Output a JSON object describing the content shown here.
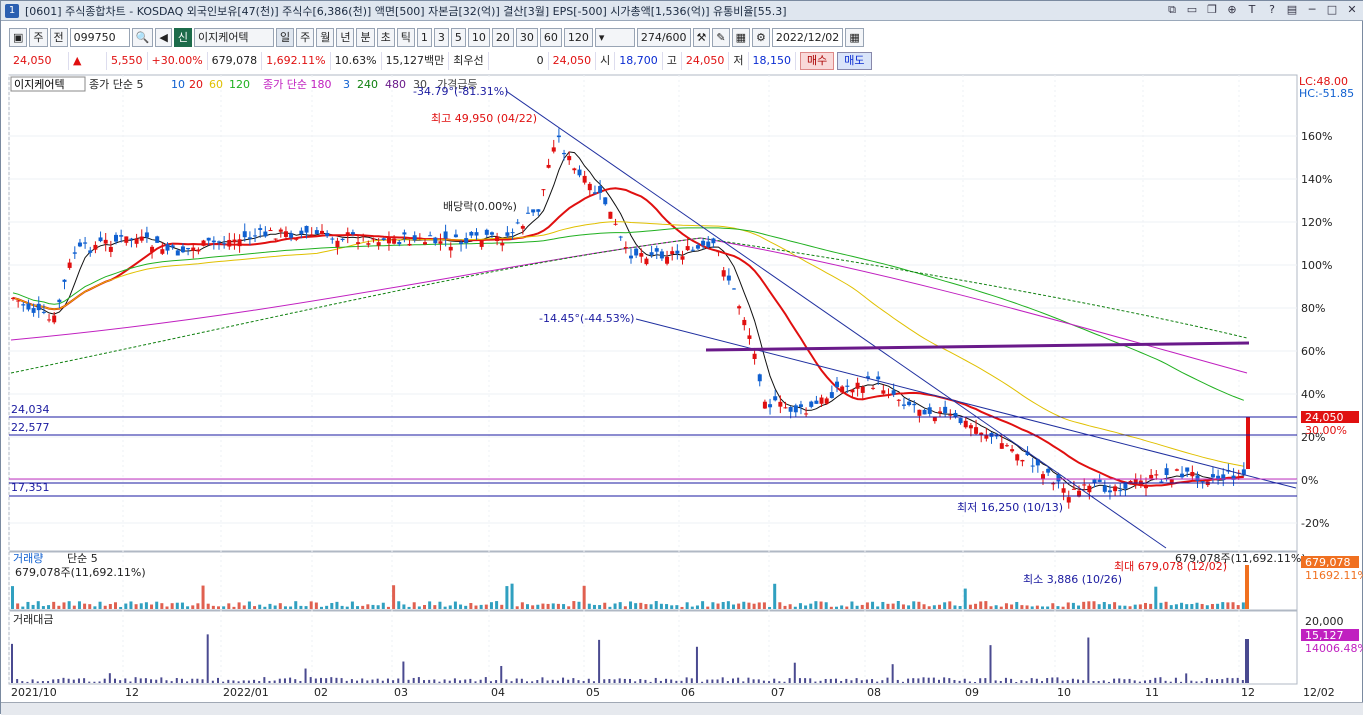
{
  "window": {
    "number": "1",
    "title": "[0601] 주식종합차트 - KOSDAQ 외국인보유[47(천)] 주식수[6,386(천)] 액면[500] 자본금[32(억)] 결산[3월] EPS[-500] 시가총액[1,536(억)] 유통비율[55.3]"
  },
  "toolbar": {
    "period_label": "주",
    "market_label": "전",
    "code": "099750",
    "ezchart": "이지케어텍",
    "periods": [
      "일",
      "주",
      "월",
      "년",
      "분",
      "초",
      "틱"
    ],
    "nums": [
      "1",
      "3",
      "5",
      "10",
      "20",
      "30",
      "60",
      "120"
    ],
    "count": "274/600",
    "date": "2022/12/02"
  },
  "quote": {
    "price": "24,050",
    "change": "5,550",
    "rate": "+30.00%",
    "volume": "679,078",
    "vol_rate": "1,692.11%",
    "turnover": "10.63%",
    "amount": "15,127백만",
    "pref_label": "최우선",
    "pref_value": "0",
    "cur": "24,050",
    "open_label": "시",
    "open": "18,700",
    "high_label": "고",
    "high": "24,050",
    "low_label": "저",
    "low": "18,150",
    "buy": "매수",
    "sell": "매도"
  },
  "legend": {
    "name": "이지케어텍",
    "ma_a": "종가 단순 5",
    "ma_a1": "10",
    "ma_a2": "20",
    "ma_a3": "60",
    "ma_a4": "120",
    "ma_b": "종가 단순 180",
    "ma_b1": "3",
    "ma_b2": "240",
    "ma_b3": "480",
    "ma_b4": "30",
    "gap": "가격급등"
  },
  "annotations": {
    "trend1": "-34.79°(-81.31%)",
    "high": "최고 49,950 (04/22)",
    "div": "배당락(0.00%)",
    "trend2": "-14.45°(-44.53%)",
    "low": "최저 16,250 (10/13)",
    "h1": "24,034",
    "h2": "22,577",
    "h3": "17,351",
    "lc": "LC:48.00",
    "hc": "HC:-51.85",
    "tag_price": "24,050",
    "tag_pct": "30.00%"
  },
  "yaxis": [
    "160%",
    "140%",
    "120%",
    "100%",
    "80%",
    "60%",
    "40%",
    "20%",
    "0%",
    "-20%"
  ],
  "volume": {
    "title": "거래량",
    "ma": "단순 5",
    "value": "679,078주(11,692.11%)",
    "max": "최대 679,078 (12/02)",
    "min": "최소 3,886 (10/26)",
    "right": "679,078주(11,692.11%)",
    "tag": "679,078",
    "tag2": "11692.11%"
  },
  "amount": {
    "title": "거래대금",
    "axis": "20,000",
    "tag": "15,127",
    "tag2": "14006.48%"
  },
  "xaxis": [
    "2021/10",
    "12",
    "2022/01",
    "02",
    "03",
    "04",
    "05",
    "06",
    "07",
    "08",
    "09",
    "10",
    "11",
    "12",
    "12/02"
  ],
  "colors": {
    "up": "#e01010",
    "down": "#1060d0",
    "bg": "#ffffff"
  }
}
